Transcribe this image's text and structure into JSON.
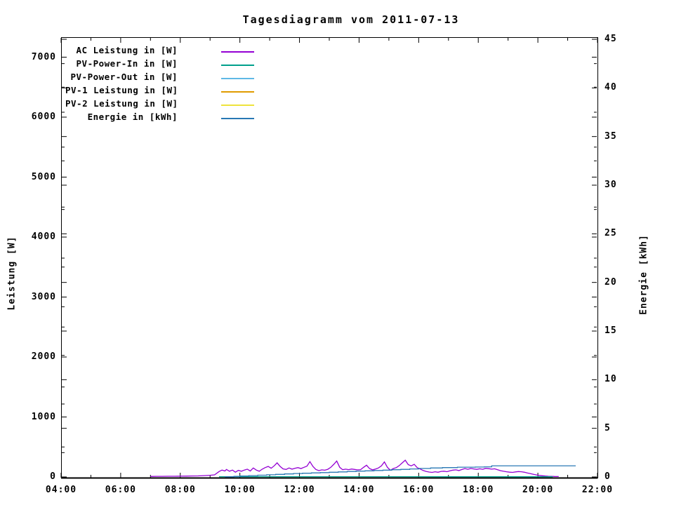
{
  "chart_data": {
    "type": "line",
    "title": "Tagesdiagramm vom 2011-07-13",
    "background": "#ffffff",
    "grid": false,
    "legend_position": "top-left-inside",
    "x_axis": {
      "label": "",
      "range_hours": [
        4,
        22
      ],
      "minor_tick_every_hours": 1,
      "ticks_major": [
        {
          "hour": 4,
          "label": "04:00"
        },
        {
          "hour": 6,
          "label": "06:00"
        },
        {
          "hour": 8,
          "label": "08:00"
        },
        {
          "hour": 10,
          "label": "10:00"
        },
        {
          "hour": 12,
          "label": "12:00"
        },
        {
          "hour": 14,
          "label": "14:00"
        },
        {
          "hour": 16,
          "label": "16:00"
        },
        {
          "hour": 18,
          "label": "18:00"
        },
        {
          "hour": 20,
          "label": "20:00"
        },
        {
          "hour": 22,
          "label": "22:00"
        }
      ]
    },
    "y_left": {
      "label": "Leistung [W]",
      "range": [
        0,
        7340
      ],
      "minor_step": 500,
      "ticks": [
        {
          "value": 0,
          "label": "0"
        },
        {
          "value": 1000,
          "label": "1000"
        },
        {
          "value": 2000,
          "label": "2000"
        },
        {
          "value": 3000,
          "label": "3000"
        },
        {
          "value": 4000,
          "label": "4000"
        },
        {
          "value": 5000,
          "label": "5000"
        },
        {
          "value": 6000,
          "label": "6000"
        },
        {
          "value": 7000,
          "label": "7000"
        }
      ]
    },
    "y_right": {
      "label": "Energie [kWh]",
      "range": [
        0,
        45.2
      ],
      "minor_step": 2.5,
      "ticks": [
        {
          "value": 0,
          "label": "0"
        },
        {
          "value": 5,
          "label": "5"
        },
        {
          "value": 10,
          "label": "10"
        },
        {
          "value": 15,
          "label": "15"
        },
        {
          "value": 20,
          "label": "20"
        },
        {
          "value": 25,
          "label": "25"
        },
        {
          "value": 30,
          "label": "30"
        },
        {
          "value": 35,
          "label": "35"
        },
        {
          "value": 40,
          "label": "40"
        },
        {
          "value": 45,
          "label": "45"
        }
      ]
    },
    "series": [
      {
        "name": "AC Leistung in [W]",
        "color": "#9400D3",
        "axis": "left",
        "step": false,
        "points": [
          [
            7.0,
            8
          ],
          [
            7.2,
            10
          ],
          [
            7.4,
            10
          ],
          [
            7.6,
            12
          ],
          [
            7.8,
            12
          ],
          [
            8.0,
            13
          ],
          [
            8.2,
            14
          ],
          [
            8.4,
            16
          ],
          [
            8.6,
            18
          ],
          [
            8.8,
            22
          ],
          [
            9.0,
            28
          ],
          [
            9.15,
            35
          ],
          [
            9.3,
            90
          ],
          [
            9.4,
            115
          ],
          [
            9.5,
            100
          ],
          [
            9.55,
            125
          ],
          [
            9.65,
            95
          ],
          [
            9.75,
            115
          ],
          [
            9.85,
            80
          ],
          [
            9.95,
            110
          ],
          [
            10.05,
            95
          ],
          [
            10.15,
            115
          ],
          [
            10.25,
            130
          ],
          [
            10.35,
            100
          ],
          [
            10.45,
            150
          ],
          [
            10.55,
            115
          ],
          [
            10.65,
            95
          ],
          [
            10.75,
            130
          ],
          [
            10.85,
            155
          ],
          [
            10.95,
            175
          ],
          [
            11.05,
            145
          ],
          [
            11.15,
            185
          ],
          [
            11.25,
            235
          ],
          [
            11.35,
            175
          ],
          [
            11.45,
            135
          ],
          [
            11.55,
            125
          ],
          [
            11.65,
            150
          ],
          [
            11.75,
            130
          ],
          [
            11.85,
            145
          ],
          [
            11.95,
            155
          ],
          [
            12.05,
            140
          ],
          [
            12.15,
            160
          ],
          [
            12.25,
            180
          ],
          [
            12.35,
            255
          ],
          [
            12.45,
            175
          ],
          [
            12.55,
            125
          ],
          [
            12.65,
            105
          ],
          [
            12.75,
            118
          ],
          [
            12.85,
            112
          ],
          [
            12.95,
            128
          ],
          [
            13.05,
            160
          ],
          [
            13.15,
            210
          ],
          [
            13.25,
            265
          ],
          [
            13.35,
            160
          ],
          [
            13.45,
            120
          ],
          [
            13.55,
            130
          ],
          [
            13.65,
            122
          ],
          [
            13.75,
            132
          ],
          [
            13.85,
            125
          ],
          [
            13.95,
            118
          ],
          [
            14.05,
            122
          ],
          [
            14.15,
            160
          ],
          [
            14.25,
            195
          ],
          [
            14.35,
            140
          ],
          [
            14.45,
            118
          ],
          [
            14.55,
            132
          ],
          [
            14.65,
            150
          ],
          [
            14.75,
            185
          ],
          [
            14.85,
            250
          ],
          [
            14.95,
            160
          ],
          [
            15.05,
            112
          ],
          [
            15.15,
            140
          ],
          [
            15.25,
            155
          ],
          [
            15.35,
            190
          ],
          [
            15.45,
            235
          ],
          [
            15.55,
            280
          ],
          [
            15.65,
            205
          ],
          [
            15.75,
            185
          ],
          [
            15.85,
            210
          ],
          [
            15.95,
            155
          ],
          [
            16.05,
            132
          ],
          [
            16.15,
            108
          ],
          [
            16.25,
            92
          ],
          [
            16.35,
            82
          ],
          [
            16.45,
            76
          ],
          [
            16.55,
            86
          ],
          [
            16.65,
            78
          ],
          [
            16.75,
            92
          ],
          [
            16.85,
            96
          ],
          [
            16.95,
            88
          ],
          [
            17.05,
            102
          ],
          [
            17.15,
            114
          ],
          [
            17.25,
            118
          ],
          [
            17.35,
            106
          ],
          [
            17.45,
            124
          ],
          [
            17.55,
            140
          ],
          [
            17.65,
            128
          ],
          [
            17.75,
            142
          ],
          [
            17.85,
            133
          ],
          [
            17.95,
            126
          ],
          [
            18.05,
            136
          ],
          [
            18.15,
            128
          ],
          [
            18.25,
            144
          ],
          [
            18.35,
            138
          ],
          [
            18.45,
            130
          ],
          [
            18.55,
            136
          ],
          [
            18.65,
            120
          ],
          [
            18.75,
            104
          ],
          [
            18.85,
            95
          ],
          [
            18.95,
            86
          ],
          [
            19.05,
            80
          ],
          [
            19.15,
            76
          ],
          [
            19.25,
            84
          ],
          [
            19.35,
            90
          ],
          [
            19.45,
            86
          ],
          [
            19.55,
            78
          ],
          [
            19.65,
            66
          ],
          [
            19.75,
            55
          ],
          [
            19.85,
            44
          ],
          [
            19.95,
            34
          ],
          [
            20.05,
            26
          ],
          [
            20.15,
            20
          ],
          [
            20.25,
            15
          ],
          [
            20.35,
            12
          ],
          [
            20.45,
            10
          ],
          [
            20.55,
            8
          ],
          [
            20.65,
            7
          ],
          [
            20.7,
            7
          ]
        ]
      },
      {
        "name": "PV-Power-In in [W]",
        "color": "#00A08C",
        "axis": "left",
        "step": false,
        "points": [
          [
            9.3,
            5
          ],
          [
            12.0,
            5
          ],
          [
            15.0,
            5
          ],
          [
            18.0,
            4
          ],
          [
            20.5,
            4
          ]
        ]
      },
      {
        "name": "PV-Power-Out in [W]",
        "color": "#5FB8E6",
        "axis": "left",
        "step": false,
        "points": []
      },
      {
        "name": "PV-1 Leistung in [W]",
        "color": "#E09B00",
        "axis": "left",
        "step": false,
        "points": []
      },
      {
        "name": "PV-2 Leistung in [W]",
        "color": "#EEE33C",
        "axis": "left",
        "step": false,
        "points": []
      },
      {
        "name": "Energie in [kWh]",
        "color": "#2878B4",
        "axis": "right",
        "step": true,
        "points": [
          [
            9.5,
            0.02
          ],
          [
            9.8,
            0.06
          ],
          [
            10.0,
            0.1
          ],
          [
            10.3,
            0.14
          ],
          [
            10.6,
            0.18
          ],
          [
            10.9,
            0.22
          ],
          [
            11.2,
            0.27
          ],
          [
            11.5,
            0.31
          ],
          [
            11.8,
            0.35
          ],
          [
            12.1,
            0.38
          ],
          [
            12.4,
            0.42
          ],
          [
            12.7,
            0.45
          ],
          [
            13.0,
            0.48
          ],
          [
            13.3,
            0.52
          ],
          [
            13.6,
            0.56
          ],
          [
            13.9,
            0.6
          ],
          [
            14.2,
            0.63
          ],
          [
            14.5,
            0.66
          ],
          [
            14.8,
            0.7
          ],
          [
            15.1,
            0.74
          ],
          [
            15.4,
            0.78
          ],
          [
            15.7,
            0.82
          ],
          [
            16.0,
            0.87
          ],
          [
            16.4,
            0.92
          ],
          [
            16.8,
            0.96
          ],
          [
            17.3,
            1.0
          ],
          [
            17.9,
            1.02
          ],
          [
            18.2,
            1.04
          ],
          [
            18.45,
            1.15
          ],
          [
            21.27,
            1.15
          ]
        ]
      }
    ]
  }
}
